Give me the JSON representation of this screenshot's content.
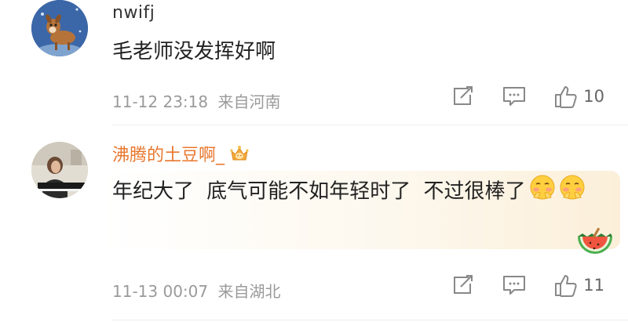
{
  "comments": [
    {
      "username": "nwifj",
      "text": "毛老师没发挥好啊",
      "timestamp": "11-12 23:18",
      "location": "来自河南",
      "likes": "10",
      "avatar_icon": "deer-cartoon-avatar"
    },
    {
      "username": "沸腾的土豆啊_",
      "text": "年纪大了 底气可能不如年轻时了 不过很棒了",
      "timestamp": "11-13 00:07",
      "location": "来自湖北",
      "likes": "11",
      "avatar_icon": "pianist-photo-avatar",
      "badge_icon": "crown-badge-icon",
      "emoji_icon": "shy-face-emoji",
      "decoration_icon": "watermelon-icon"
    }
  ],
  "colors": {
    "username_vip": "#e8772e",
    "meta_text": "#9a9a9a",
    "icon": "#888888"
  }
}
